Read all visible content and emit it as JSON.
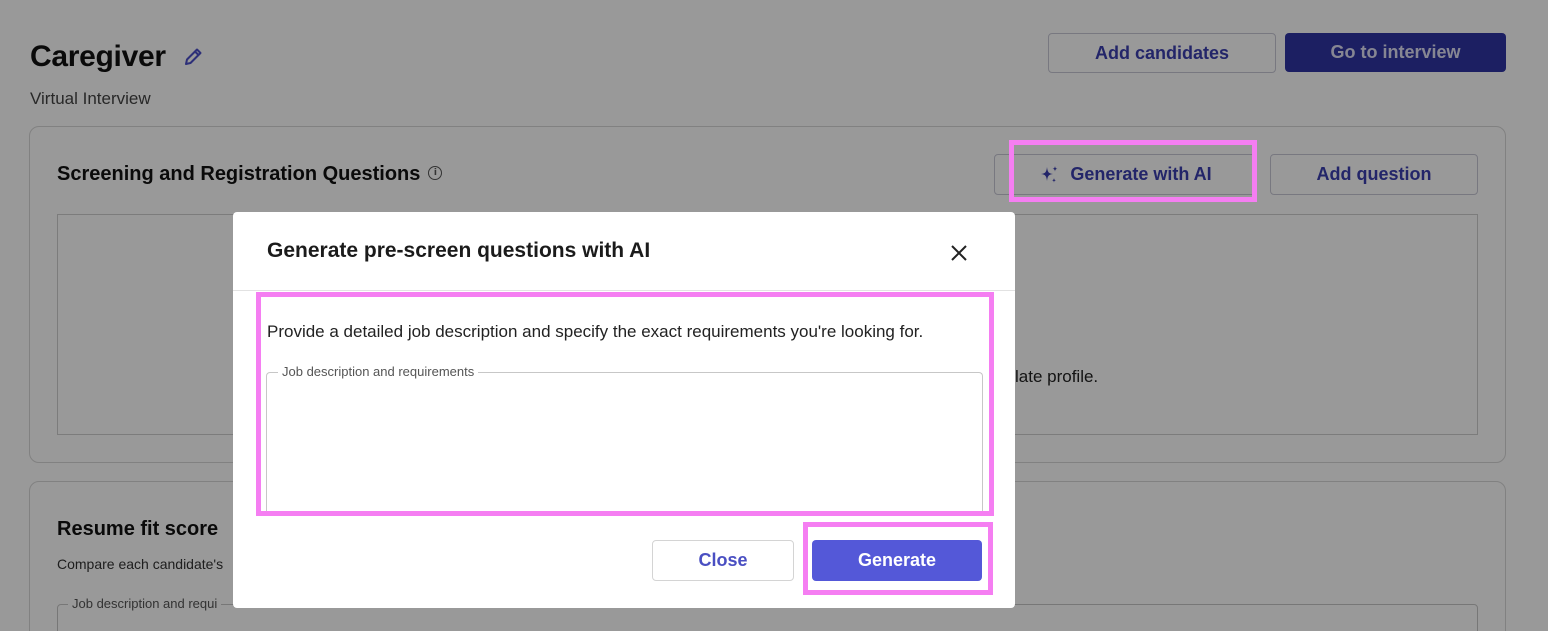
{
  "page": {
    "title": "Caregiver",
    "subtitle": "Virtual Interview"
  },
  "header_actions": {
    "add_candidates_label": "Add candidates",
    "go_to_interview_label": "Go to interview"
  },
  "screening_section": {
    "title": "Screening and Registration Questions",
    "generate_ai_label": "Generate with AI",
    "add_question_label": "Add question",
    "empty_text_fragment": "late profile."
  },
  "resume_section": {
    "title": "Resume fit score",
    "description_fragment": "Compare each candidate's",
    "field_legend_fragment": "Job description and requi"
  },
  "modal": {
    "title": "Generate pre-screen questions with AI",
    "description": "Provide a detailed job description and specify the exact requirements you're looking for.",
    "field_label": "Job description and requirements",
    "field_value": "",
    "close_label": "Close",
    "generate_label": "Generate"
  },
  "icons": {
    "edit": "pencil-icon",
    "info": "info-icon",
    "sparkle": "sparkle-icon",
    "close": "close-icon"
  },
  "colors": {
    "accent": "#3b3fb0",
    "primary_button": "#2f34a3",
    "generate_button": "#5458d8",
    "highlight": "#f57ef2"
  }
}
